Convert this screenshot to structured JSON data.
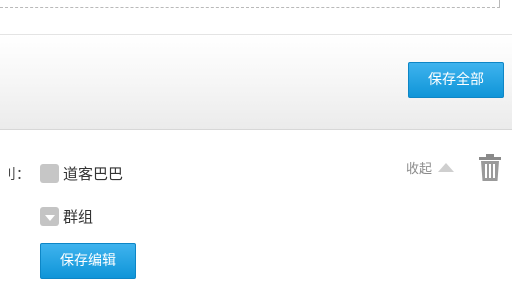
{
  "toolbar": {
    "save_all_label": "保存全部"
  },
  "form": {
    "row_label_partial": "刂：",
    "checkbox_daoke_label": "道客巴巴",
    "checkbox_group_label": "群组",
    "collapse_label": "收起",
    "save_edit_label": "保存编辑"
  },
  "icons": {
    "collapse": "caret-up-icon",
    "delete": "trash-icon",
    "group_toggle": "chevron-down-icon"
  },
  "colors": {
    "primary_button": "#1ea3e6",
    "checkbox_gray": "#c6c6c6"
  }
}
